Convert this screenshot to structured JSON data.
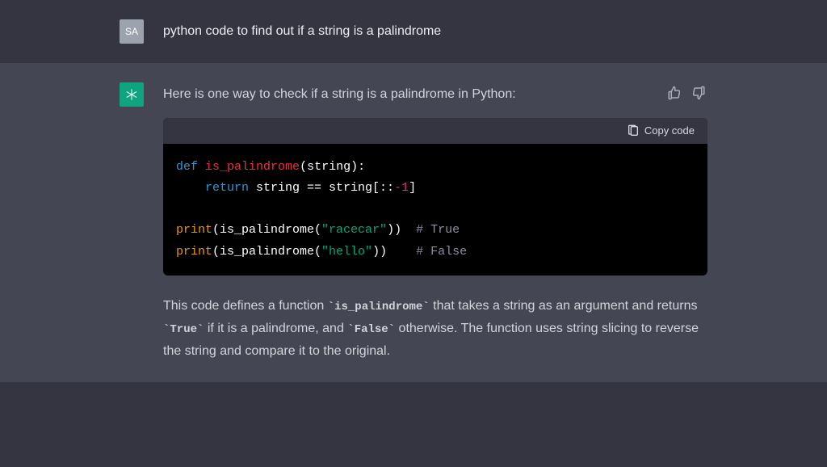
{
  "user": {
    "avatar_initials": "SA",
    "message": "python code to find out if a string is a palindrome"
  },
  "assistant": {
    "intro": "Here is one way to check if a string is a palindrome in Python:",
    "copy_label": "Copy code",
    "code": {
      "line1": {
        "kw_def": "def",
        "func": "is_palindrome",
        "params": "(string):"
      },
      "line2": {
        "kw_return": "return",
        "expr_left": " string == string[::",
        "neg1": "-1",
        "expr_right": "]"
      },
      "line4": {
        "print": "print",
        "open": "(is_palindrome(",
        "str": "\"racecar\"",
        "close": "))  ",
        "comment": "# True"
      },
      "line5": {
        "print": "print",
        "open": "(is_palindrome(",
        "str": "\"hello\"",
        "close": "))    ",
        "comment": "# False"
      }
    },
    "explanation": {
      "part1": "This code defines a function ",
      "code1": "`is_palindrome`",
      "part2": " that takes a string as an argument and returns ",
      "code2": "`True`",
      "part3": " if it is a palindrome, and ",
      "code3": "`False`",
      "part4": " otherwise. The function uses string slicing to reverse the string and compare it to the original."
    }
  }
}
